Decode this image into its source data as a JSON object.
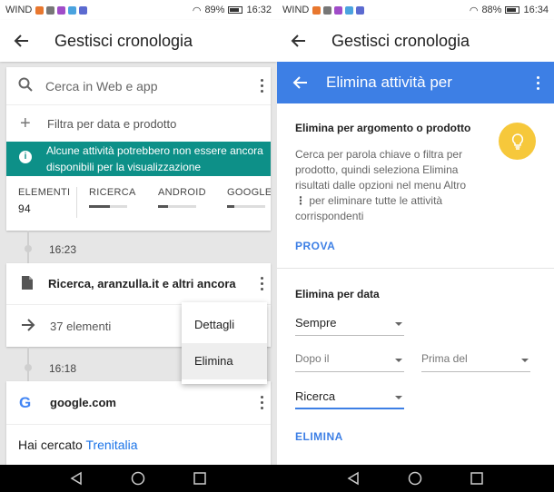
{
  "left": {
    "status": {
      "carrier": "WIND",
      "battery": "89%",
      "time": "16:32"
    },
    "title": "Gestisci cronologia",
    "search_placeholder": "Cerca in Web e app",
    "filter_label": "Filtra per data e prodotto",
    "banner_text": "Alcune attività potrebbero non essere ancora disponibili per la visualizzazione",
    "stats": [
      {
        "label": "ELEMENTI",
        "value": "94"
      },
      {
        "label": "RICERCA",
        "fill": 0.55
      },
      {
        "label": "ANDROID",
        "fill": 0.25
      },
      {
        "label": "GOOGLE P",
        "fill": 0.2
      }
    ],
    "time1": "16:23",
    "activity_title": "Ricerca, aranzulla.it e altri ancora",
    "activity_count": "37 elementi",
    "menu": [
      "Dettagli",
      "Elimina"
    ],
    "time2": "16:18",
    "google_title": "google.com",
    "google_body_prefix": "Hai cercato",
    "google_body_link": "Trenitalia"
  },
  "right": {
    "status": {
      "carrier": "WIND",
      "battery": "88%",
      "time": "16:34"
    },
    "title": "Gestisci cronologia",
    "bar_title": "Elimina attività per",
    "sec1_heading": "Elimina per argomento o prodotto",
    "sec1_desc_a": "Cerca per parola chiave o filtra per prodotto, quindi seleziona Elimina risultati dalle opzioni nel menu Altro",
    "sec1_desc_b": "per eliminare tutte le attività corrispondenti",
    "prova": "PROVA",
    "sec2_heading": "Elimina per data",
    "range_value": "Sempre",
    "after_label": "Dopo il",
    "before_label": "Prima del",
    "product_value": "Ricerca",
    "elimina": "ELIMINA"
  },
  "colors": {
    "accent_blue": "#3d7fe5",
    "teal": "#0d9088",
    "bulb": "#f6c83b"
  }
}
